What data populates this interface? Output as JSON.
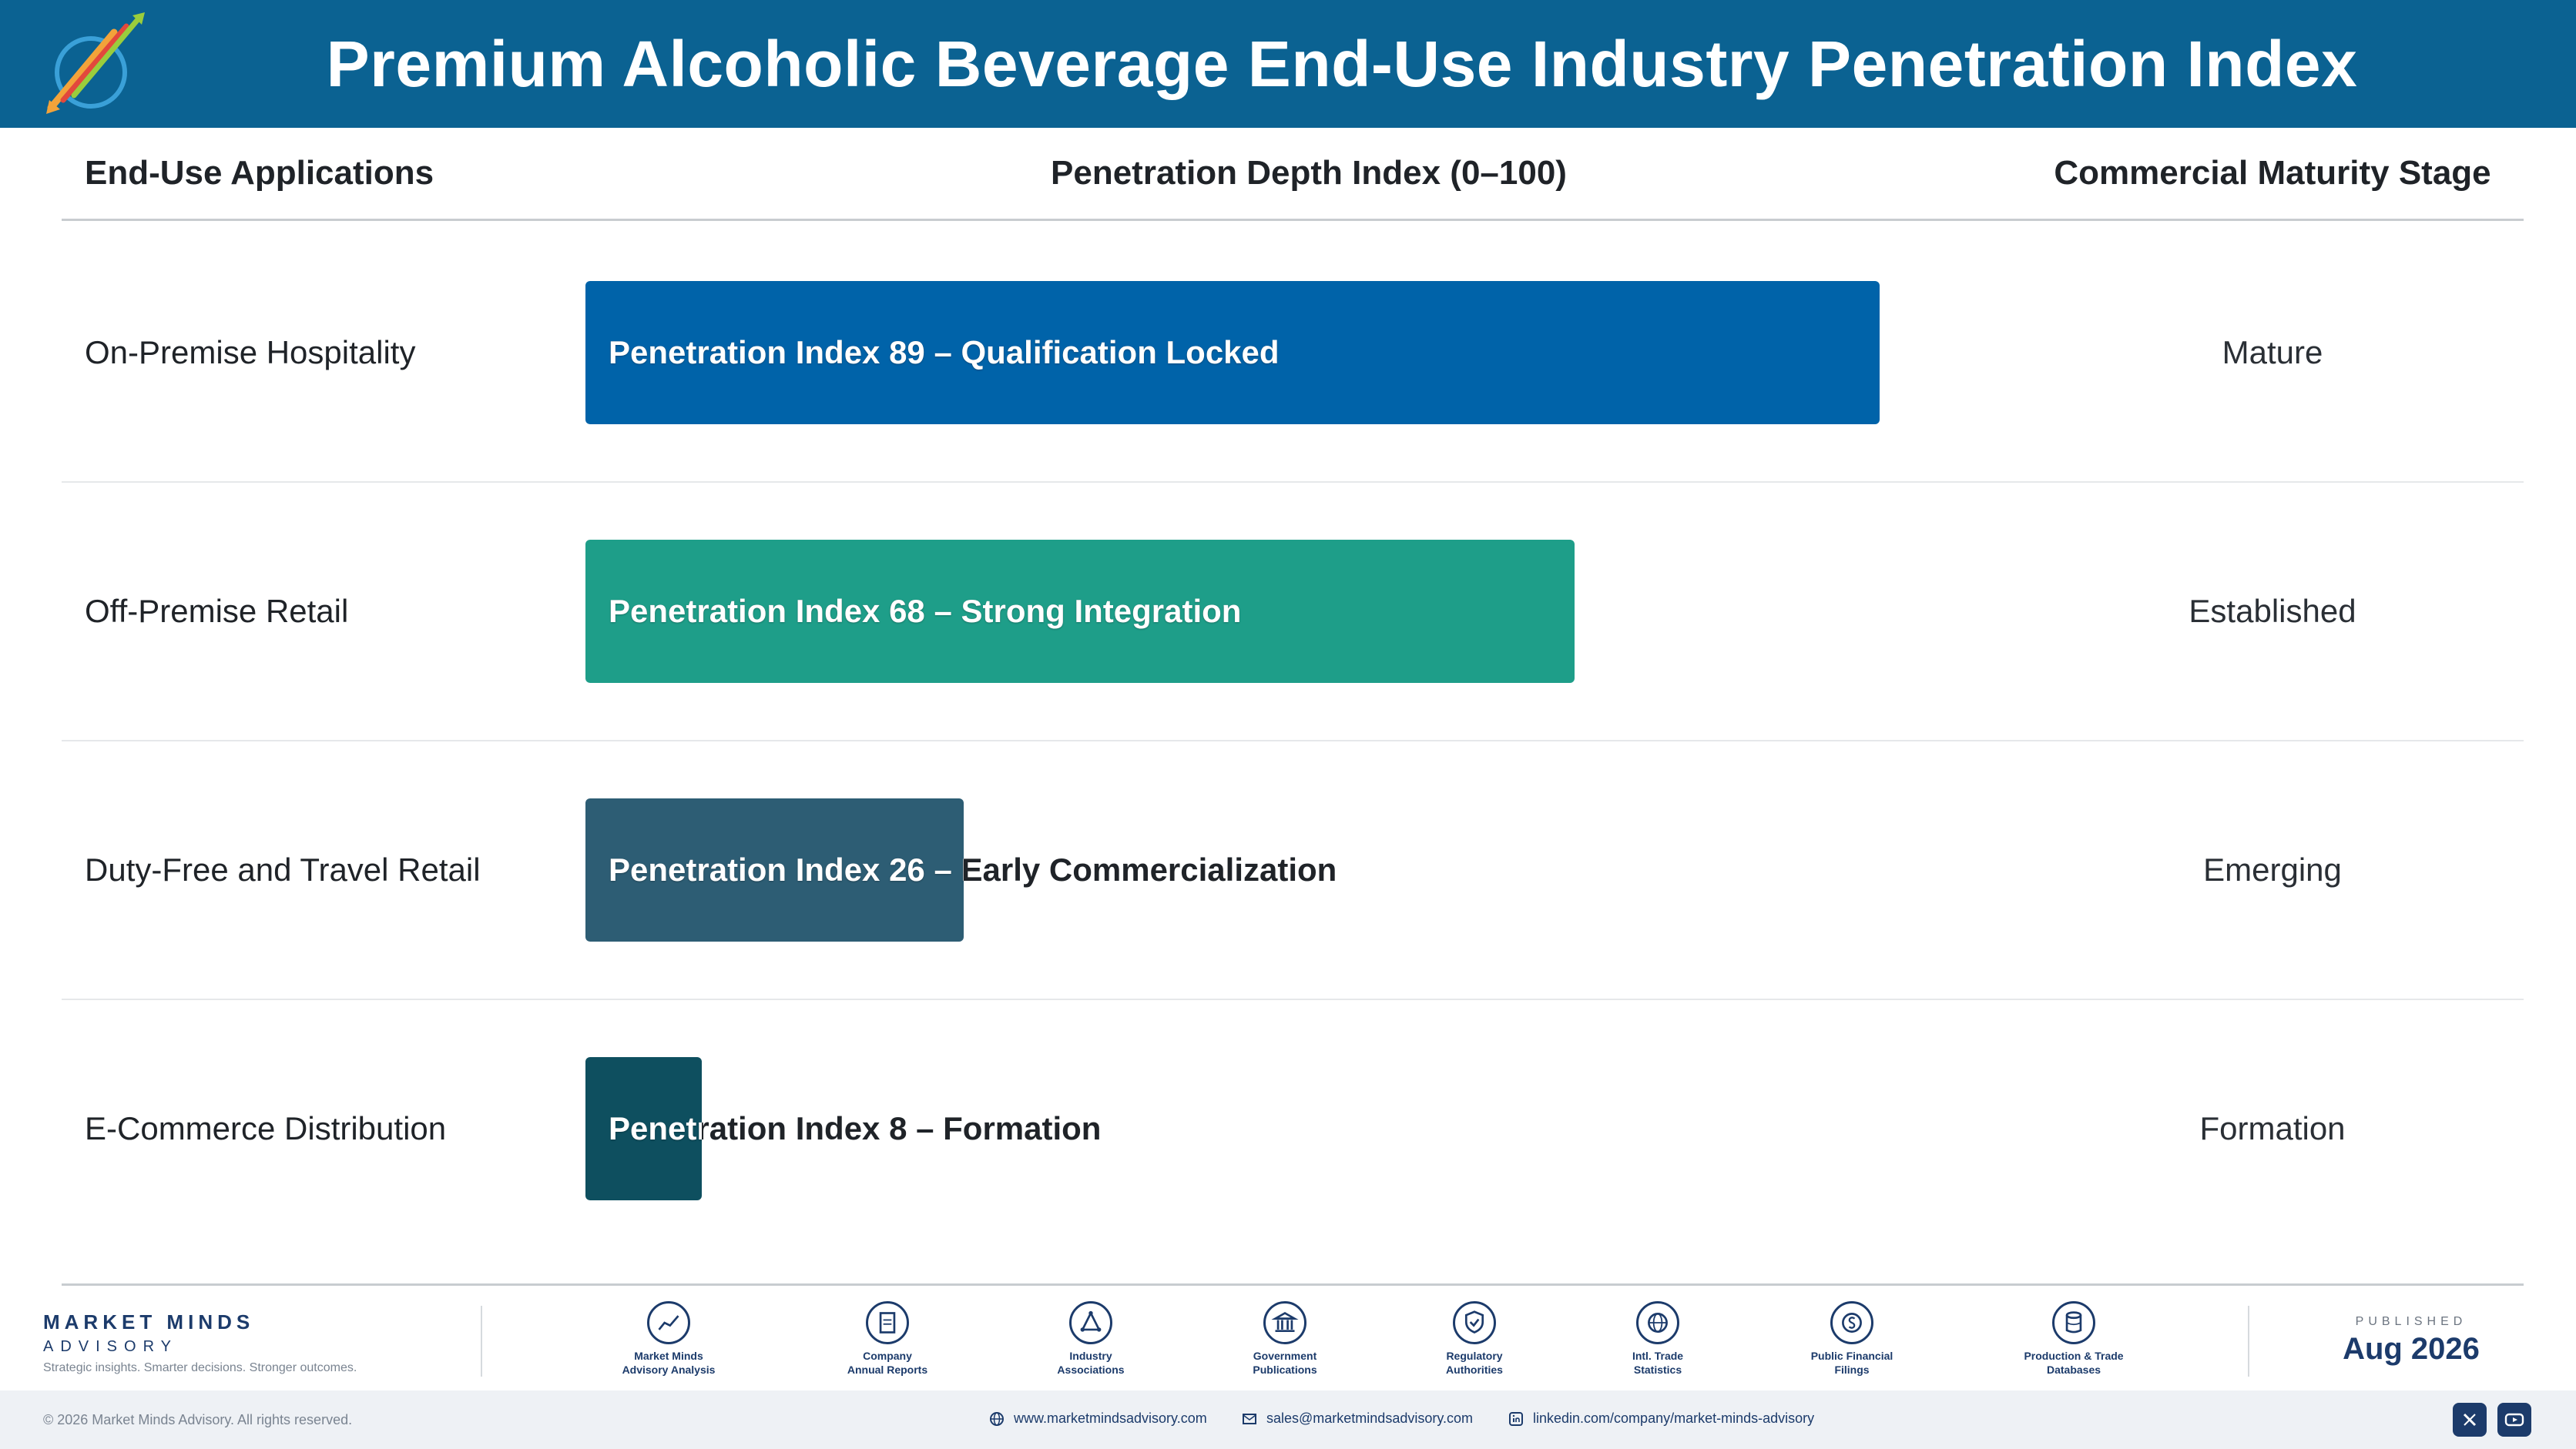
{
  "header": {
    "title": "Premium Alcoholic Beverage End-Use Industry Penetration Index",
    "logo_icon": "market-minds-arrows-logo-icon"
  },
  "columns": {
    "applications": "End-Use Applications",
    "penetration": "Penetration Depth Index (0–100)",
    "stage": "Commercial Maturity Stage"
  },
  "chart_data": {
    "type": "bar",
    "orientation": "horizontal",
    "xlim": [
      0,
      100
    ],
    "categories": [
      "On-Premise Hospitality",
      "Off-Premise Retail",
      "Duty-Free and Travel Retail",
      "E-Commerce Distribution"
    ],
    "values": [
      89,
      68,
      26,
      8
    ],
    "bar_labels": [
      "Penetration Index 89 – Qualification Locked",
      "Penetration Index 68 – Strong Integration",
      "Penetration Index 26 – Early Commercialization",
      "Penetration Index 8 – Formation"
    ],
    "stages": [
      "Mature",
      "Established",
      "Emerging",
      "Formation"
    ],
    "colors": [
      "#0063a9",
      "#1e9e89",
      "#2d5d74",
      "#0e4f5f"
    ]
  },
  "footer": {
    "brand_name": "MARKET MINDS",
    "brand_sub": "ADVISORY",
    "brand_tagline": "Strategic insights. Smarter decisions. Stronger outcomes.",
    "sources": [
      {
        "line1": "Market Minds",
        "line2": "Advisory Analysis",
        "icon": "trend-line-icon"
      },
      {
        "line1": "Company",
        "line2": "Annual Reports",
        "icon": "document-icon"
      },
      {
        "line1": "Industry",
        "line2": "Associations",
        "icon": "network-icon"
      },
      {
        "line1": "Government",
        "line2": "Publications",
        "icon": "government-building-icon"
      },
      {
        "line1": "Regulatory",
        "line2": "Authorities",
        "icon": "shield-check-icon"
      },
      {
        "line1": "Intl. Trade",
        "line2": "Statistics",
        "icon": "globe-icon"
      },
      {
        "line1": "Public Financial",
        "line2": "Filings",
        "icon": "dollar-coin-icon"
      },
      {
        "line1": "Production & Trade",
        "line2": "Databases",
        "icon": "database-icon"
      }
    ],
    "published_label": "PUBLISHED",
    "published_date": "Aug 2026",
    "copyright": "© 2026 Market Minds Advisory. All rights reserved.",
    "website": "www.marketmindsadvisory.com",
    "email": "sales@marketmindsadvisory.com",
    "linkedin": "linkedin.com/company/market-minds-advisory"
  }
}
